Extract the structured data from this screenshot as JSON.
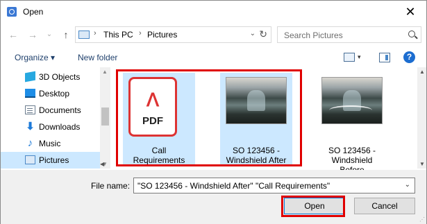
{
  "window": {
    "title": "Open",
    "close_glyph": "✕",
    "icon": "app-icon"
  },
  "nav": {
    "back_glyph": "←",
    "forward_glyph": "→",
    "recent_glyph": "⌄",
    "up_glyph": "↑",
    "breadcrumb": [
      "This PC",
      "Pictures"
    ],
    "crumb_separator": "›",
    "refresh_glyph": "↻",
    "dropdown_glyph": "⌄",
    "search_placeholder": "Search Pictures"
  },
  "toolbar": {
    "organize_label": "Organize ▾",
    "new_folder_label": "New folder",
    "view_dropdown_glyph": "▾",
    "help_glyph": "?"
  },
  "sidebar": {
    "items": [
      {
        "label": "3D Objects",
        "icon": "3d-objects-icon",
        "selected": false
      },
      {
        "label": "Desktop",
        "icon": "desktop-icon",
        "selected": false
      },
      {
        "label": "Documents",
        "icon": "documents-icon",
        "selected": false
      },
      {
        "label": "Downloads",
        "icon": "downloads-icon",
        "selected": false
      },
      {
        "label": "Music",
        "icon": "music-icon",
        "selected": false
      },
      {
        "label": "Pictures",
        "icon": "pictures-icon",
        "selected": true
      }
    ],
    "download_glyph": "⬇",
    "music_glyph": "♪",
    "scroll_up_glyph": "▲",
    "scroll_down_glyph": "▼"
  },
  "files": [
    {
      "name_line1": "Call",
      "name_line2": "Requirements",
      "name_line3": "",
      "type": "pdf",
      "selected": true,
      "pdf_glyph": "ᐱ",
      "pdf_text": "PDF"
    },
    {
      "name_line1": "SO 123456 -",
      "name_line2": "Windshield After",
      "name_line3": "",
      "type": "photo",
      "selected": true
    },
    {
      "name_line1": "SO 123456 -",
      "name_line2": "Windshield",
      "name_line3": "Before",
      "type": "photo",
      "selected": false
    }
  ],
  "file_scroll": {
    "up_glyph": "▲",
    "down_glyph": "▼",
    "hscroll_glyph": "◀"
  },
  "bottom": {
    "file_name_label": "File name:",
    "file_name_value": "\"SO 123456 - Windshield After\" \"Call Requirements\"",
    "dropdown_glyph": "⌄",
    "open_label": "Open",
    "cancel_label": "Cancel",
    "grip_glyph": "⋰"
  },
  "colors": {
    "highlight": "#e00000",
    "selection": "#cce8ff",
    "accent": "#0078d7"
  }
}
